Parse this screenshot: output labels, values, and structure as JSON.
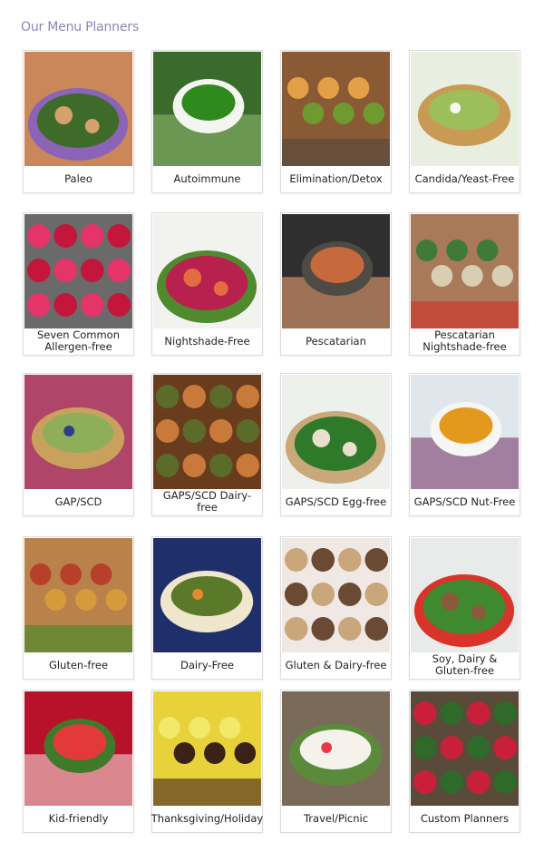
{
  "page": {
    "title": "Our Menu Planners"
  },
  "planners": [
    {
      "label": "Paleo",
      "icon": "salad-bowl-photo",
      "palette": [
        "#c9875a",
        "#3f6b2a",
        "#8b64b8",
        "#d8a06a"
      ]
    },
    {
      "label": "Autoimmune",
      "icon": "pesto-bowl-photo",
      "palette": [
        "#3a6a2c",
        "#2f8a1e",
        "#f4f4f0",
        "#8bb56a"
      ]
    },
    {
      "label": "Elimination/Detox",
      "icon": "vegetable-pot-photo",
      "palette": [
        "#8a5a34",
        "#6f9a2f",
        "#5a4a40",
        "#e3a046"
      ]
    },
    {
      "label": "Candida/Yeast-Free",
      "icon": "soup-bowl-photo",
      "palette": [
        "#e9efe0",
        "#f7f7f2",
        "#c99a54",
        "#9cbf5c"
      ]
    },
    {
      "label": "Seven Common\nAllergen-free",
      "icon": "smoothie-glasses-photo",
      "palette": [
        "#6a6a6a",
        "#c4163a",
        "#2e2e2e",
        "#e4346a"
      ]
    },
    {
      "label": "Nightshade-Free",
      "icon": "radish-bunch-photo",
      "palette": [
        "#f2f2ee",
        "#b8204e",
        "#4f8a2e",
        "#e46d40"
      ]
    },
    {
      "label": "Pescatarian",
      "icon": "salmon-fillet-photo",
      "palette": [
        "#2f2f2f",
        "#c66a3e",
        "#4e4a44",
        "#e8a072"
      ]
    },
    {
      "label": "Pescatarian\nNightshade-free",
      "icon": "stew-bowl-photo",
      "palette": [
        "#a87a5a",
        "#d9cdb2",
        "#cf3a2e",
        "#3f7a3a"
      ]
    },
    {
      "label": "GAP/SCD",
      "icon": "muffins-plate-photo",
      "palette": [
        "#b0456a",
        "#2b3f86",
        "#c9a15c",
        "#8fae5a"
      ]
    },
    {
      "label": "GAPS/SCD Dairy-free",
      "icon": "roast-chicken-photo",
      "palette": [
        "#6a3c1e",
        "#c9793a",
        "#d89a46",
        "#5a6b2a"
      ]
    },
    {
      "label": "GAPS/SCD Egg-free",
      "icon": "spinach-salad-photo",
      "palette": [
        "#eef0ec",
        "#2f7a2a",
        "#c9a87a",
        "#e8e0cc"
      ]
    },
    {
      "label": "GAPS/SCD Nut-Free",
      "icon": "squash-soup-photo",
      "palette": [
        "#dfe6ec",
        "#e39a1c",
        "#f6f6f4",
        "#7a3a6a"
      ]
    },
    {
      "label": "Gluten-free",
      "icon": "vegetable-pizza-photo",
      "palette": [
        "#b9824a",
        "#d79a3a",
        "#4e8a2e",
        "#b8402a"
      ]
    },
    {
      "label": "Dairy-Free",
      "icon": "tofu-bowl-photo",
      "palette": [
        "#1e2f6a",
        "#e78a2e",
        "#efe6cc",
        "#5a7a2a"
      ]
    },
    {
      "label": "Gluten & Dairy-free",
      "icon": "seeded-bread-photo",
      "palette": [
        "#efe8e4",
        "#6a4a32",
        "#d23a4a",
        "#c9a77a"
      ]
    },
    {
      "label": "Soy, Dairy &\nGluten-free",
      "icon": "garden-salad-photo",
      "palette": [
        "#e9eaea",
        "#3f8a2e",
        "#d8342a",
        "#8a5a3a"
      ]
    },
    {
      "label": "Kid-friendly",
      "icon": "strawberries-bowl-photo",
      "palette": [
        "#b8122a",
        "#e23a3a",
        "#3f7a2a",
        "#f2d6d6"
      ]
    },
    {
      "label": "Thanksgiving/Holiday",
      "icon": "chocolate-hearts-photo",
      "palette": [
        "#e8d23a",
        "#3a2216",
        "#5a3a24",
        "#f2e86a"
      ]
    },
    {
      "label": "Travel/Picnic",
      "icon": "watermelon-slices-photo",
      "palette": [
        "#7a6a5a",
        "#e8384a",
        "#5a8a3a",
        "#f4f2ea"
      ]
    },
    {
      "label": "Custom Planners",
      "icon": "rainbow-salad-photo",
      "palette": [
        "#5a4a3a",
        "#2f6a2a",
        "#e89a2e",
        "#c8203a"
      ]
    }
  ]
}
